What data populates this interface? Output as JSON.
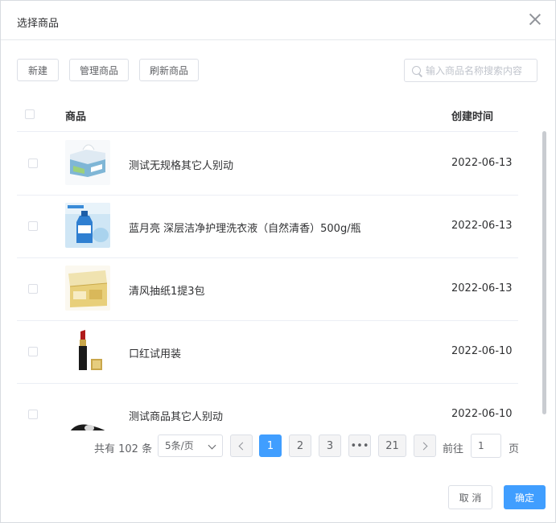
{
  "dialog": {
    "title": "选择商品"
  },
  "toolbar": {
    "new_label": "新建",
    "manage_label": "管理商品",
    "refresh_label": "刷新商品",
    "search_placeholder": "输入商品名称搜索内容"
  },
  "table": {
    "columns": {
      "product": "商品",
      "created": "创建时间"
    },
    "rows": [
      {
        "name": "测试无规格其它人别动",
        "date": "2022-06-13",
        "image": "tissue-box-image"
      },
      {
        "name": "蓝月亮 深层洁净护理洗衣液（自然清香）500g/瓶",
        "date": "2022-06-13",
        "image": "detergent-bottle-image"
      },
      {
        "name": "清风抽纸1提3包",
        "date": "2022-06-13",
        "image": "tissue-pack-image"
      },
      {
        "name": "口红试用装",
        "date": "2022-06-10",
        "image": "lipstick-image"
      },
      {
        "name": "测试商品其它人别动",
        "date": "2022-06-10",
        "image": "shoe-image"
      }
    ]
  },
  "pagination": {
    "total": "共有 102 条",
    "page_size": "5条/页",
    "pages": [
      "1",
      "2",
      "3",
      "•••",
      "21"
    ],
    "current": "1",
    "goto_label": "前往",
    "goto_value": "1",
    "page_unit": "页"
  },
  "footer": {
    "cancel_label": "取 消",
    "confirm_label": "确定"
  },
  "colors": {
    "primary": "#409eff",
    "border": "#dcdfe6",
    "text": "#303133"
  }
}
